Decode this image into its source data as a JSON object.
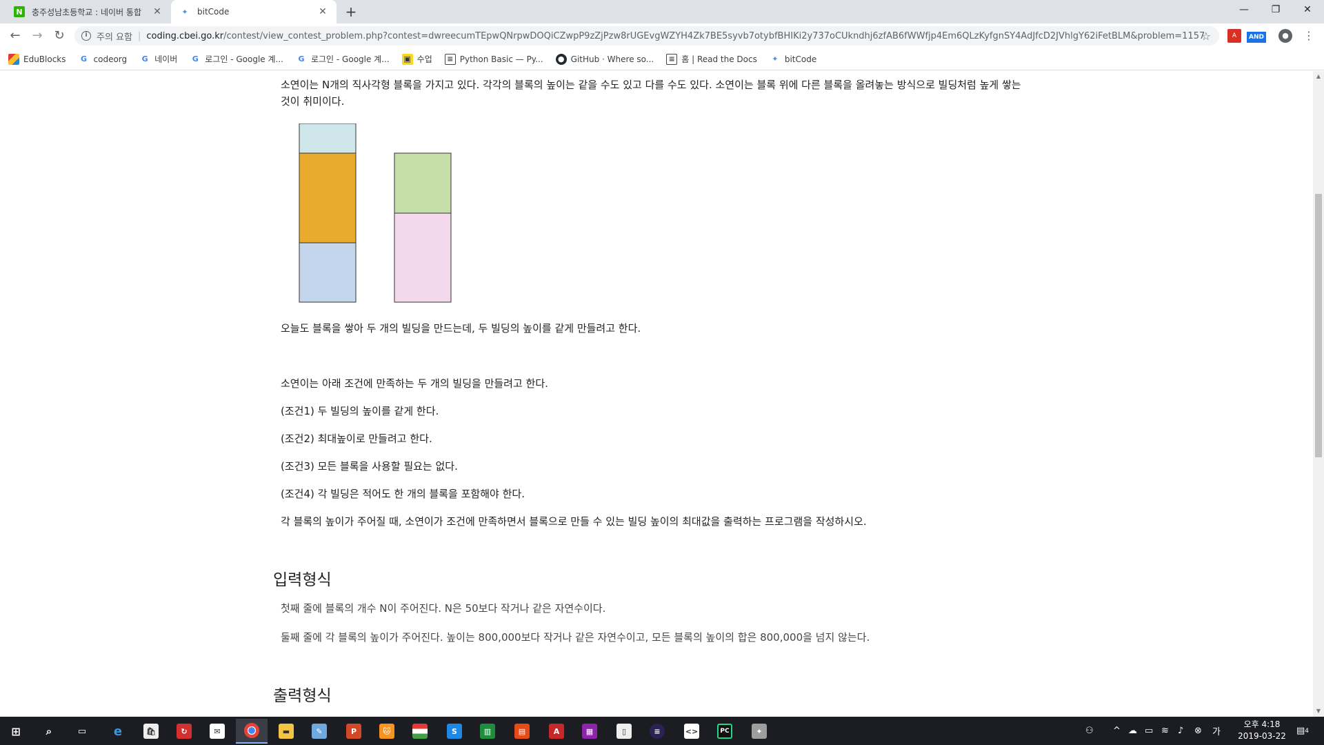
{
  "browser": {
    "tabs": [
      {
        "title": "충주성남초등학교 : 네이버 통합",
        "favicon": "N"
      },
      {
        "title": "bitCode",
        "favicon": "bitcode-icon"
      }
    ],
    "address": {
      "security_label": "주의 요함",
      "host": "coding.cbei.go.kr",
      "path": "/contest/view_contest_problem.php?contest=dwreecumTEpwQNrpwDOQiCZwpP9zZjPzw8rUGEvgWZYH4Zk7BE5syvb7otybfBHIKi2y737oCUkndhj6zfAB6fWWfjp4Em6QLzKyfgnSY4AdJfcD2JVhlgY62iFetBLM&problem=1157"
    },
    "extensions": {
      "and_label": "AND"
    },
    "bookmarks": [
      {
        "label": "EduBlocks",
        "icon": "edublocks-icon"
      },
      {
        "label": "codeorg",
        "icon": "google-icon"
      },
      {
        "label": "네이버",
        "icon": "google-icon"
      },
      {
        "label": "로그인 - Google 계...",
        "icon": "google-icon"
      },
      {
        "label": "로그인 - Google 계...",
        "icon": "google-icon"
      },
      {
        "label": "수업",
        "icon": "class-icon"
      },
      {
        "label": "Python Basic — Py...",
        "icon": "doc-icon"
      },
      {
        "label": "GitHub · Where so...",
        "icon": "github-icon"
      },
      {
        "label": "홈 | Read the Docs",
        "icon": "doc-icon"
      },
      {
        "label": "bitCode",
        "icon": "bitcode-icon"
      }
    ]
  },
  "problem": {
    "intro": "소연이는 N개의 직사각형 블록을 가지고 있다. 각각의 블록의 높이는 같을 수도 있고 다를 수도 있다. 소연이는 블록 위에 다른 블록을 올려놓는 방식으로 빌딩처럼 높게 쌓는 것이 취미이다.",
    "illustration": {
      "left_stack": [
        "#cfe7ea",
        "#e8ab2e",
        "#c3d6ec"
      ],
      "right_stack": [
        "#c6dfa8",
        "#f3d9eb"
      ]
    },
    "line1": "오늘도 블록을 쌓아 두 개의 빌딩을 만드는데, 두 빌딩의 높이를 같게 만들려고 한다.",
    "line2": "소연이는 아래 조건에 만족하는 두 개의 빌딩을 만들려고 한다.",
    "cond1": "(조건1) 두 빌딩의 높이를 같게 한다.",
    "cond2": "(조건2) 최대높이로 만들려고 한다.",
    "cond3": "(조건3) 모든 블록을 사용할 필요는 없다.",
    "cond4": "(조건4) 각 빌딩은 적어도 한 개의 블록을 포함해야 한다.",
    "task": "각 블록의 높이가 주어질 때, 소연이가 조건에 만족하면서 블록으로 만들 수 있는 빌딩 높이의 최대값을 출력하는 프로그램을 작성하시오.",
    "input_heading": "입력형식",
    "input1": "첫째 줄에 블록의 개수 N이 주어진다. N은 50보다 작거나 같은 자연수이다.",
    "input2": "둘째 줄에 각 블록의 높이가 주어진다. 높이는 800,000보다 작거나 같은 자연수이고, 모든 블록의 높이의 합은 800,000을 넘지 않는다.",
    "output_heading": "출력형식"
  },
  "taskbar": {
    "clock_period": "오후 4:18",
    "clock_date": "2019-03-22",
    "notification_count": "4"
  }
}
